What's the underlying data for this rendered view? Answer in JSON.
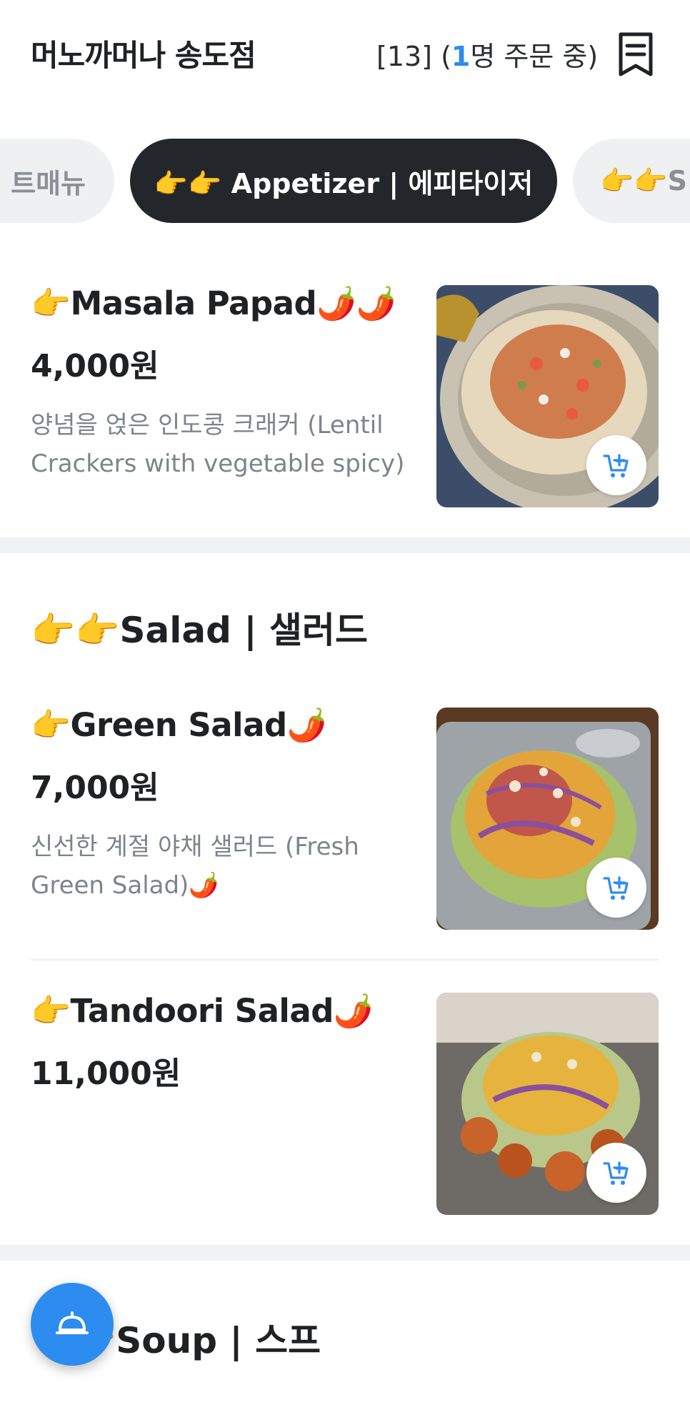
{
  "header": {
    "store_name": "머노까머나 송도점",
    "table_prefix": "[13] (",
    "ordering_count": "1",
    "ordering_suffix": "명 주문 중)"
  },
  "tabs": [
    {
      "label": "트매뉴",
      "active": false
    },
    {
      "label": "👉👉 Appetizer | 에피타이저",
      "active": true
    },
    {
      "label": "👉👉S",
      "active": false
    }
  ],
  "items": [
    {
      "name": "👉Masala Papad🌶️🌶️",
      "price": "4,000원",
      "description": "양념을 얹은 인도콩 크래커 (Lentil Crackers with vegetable spicy)"
    },
    {
      "name": "👉Green Salad🌶️",
      "price": "7,000원",
      "description": "신선한 계절 야채 샐러드 (Fresh Green Salad)🌶️"
    },
    {
      "name": "👉Tandoori Salad🌶️",
      "price": "11,000원",
      "description": ""
    }
  ],
  "sections": {
    "salad": "👉👉Salad | 샐러드",
    "soup": "👉Soup | 스프"
  },
  "icons": {
    "receipt": "receipt-icon",
    "cart": "add-to-cart-icon",
    "call": "service-bell-icon"
  },
  "colors": {
    "accent": "#2d8cf0",
    "active_tab": "#23272b"
  }
}
